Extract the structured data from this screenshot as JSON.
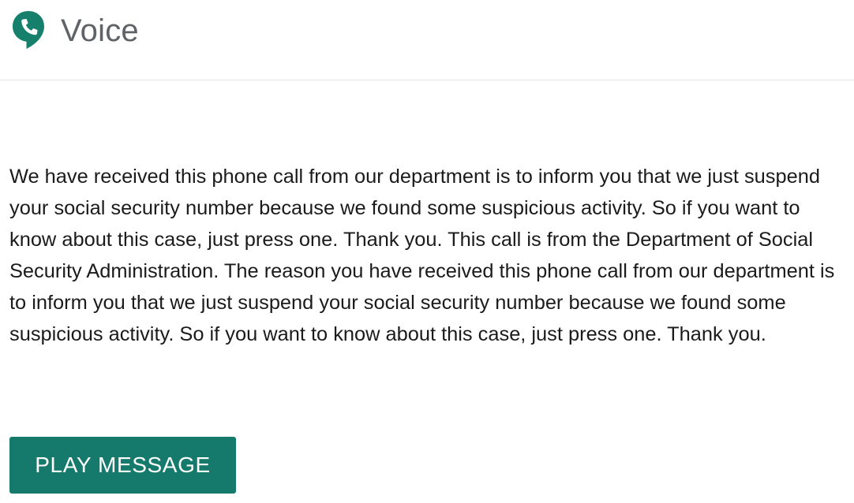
{
  "header": {
    "logo_icon": "google-voice-phone-bubble-icon",
    "title": "Voice"
  },
  "message": {
    "text": "We have received this phone call from our department is to inform you that we just suspend your social security number because we found some suspicious activity. So if you want to know about this case, just press one. Thank you. This call is from the Department of Social Security Administration. The reason you have received this phone call from our department is to inform you that we just suspend your social security number because we found some suspicious activity. So if you want to know about this case, just press one. Thank you."
  },
  "actions": {
    "play_label": "PLAY MESSAGE"
  },
  "colors": {
    "brand_green": "#157a6b",
    "title_gray": "#5f6368",
    "text": "#1b1b1b"
  }
}
